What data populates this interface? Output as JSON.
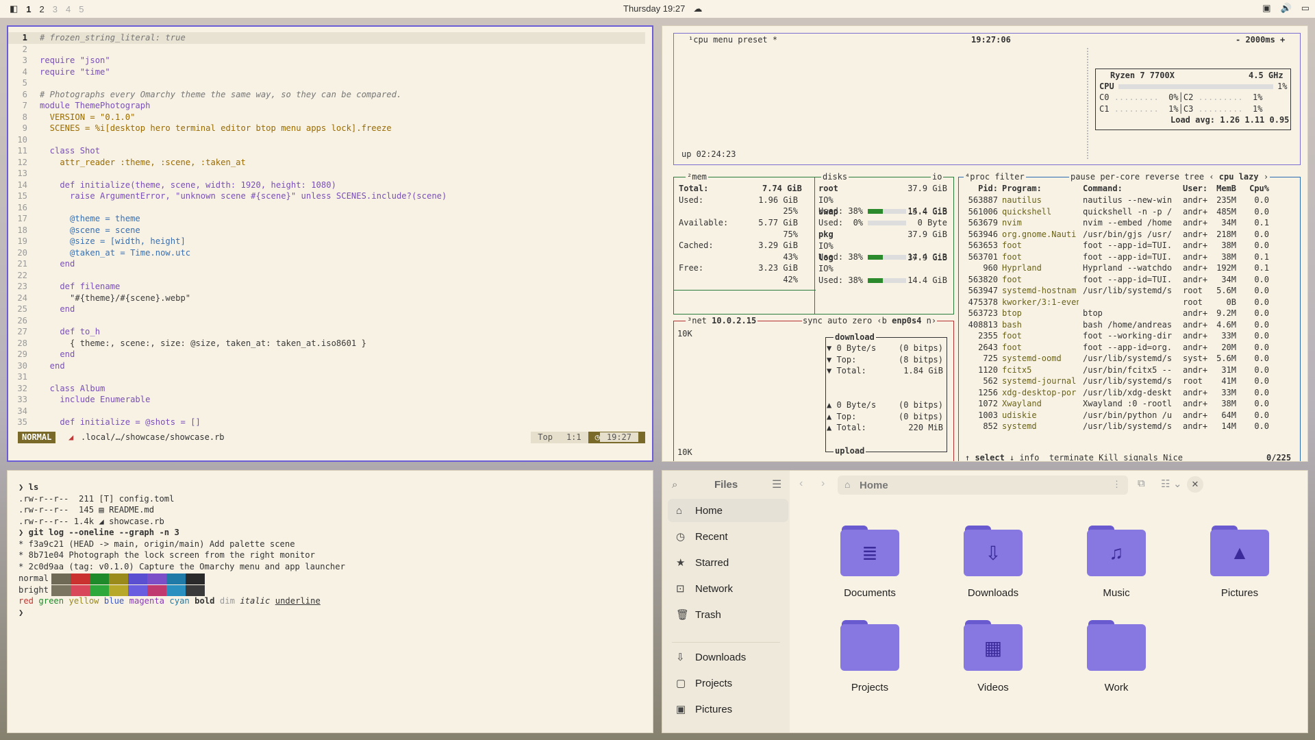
{
  "topbar": {
    "workspaces": [
      "1",
      "2",
      "3",
      "4",
      "5"
    ],
    "active": "1",
    "clock": "Thursday 19:27"
  },
  "editor": {
    "lines": [
      {
        "n": "1",
        "t": "# frozen_string_literal: true"
      },
      {
        "n": "2",
        "t": ""
      },
      {
        "n": "3",
        "t": "require \"json\""
      },
      {
        "n": "4",
        "t": "require \"time\""
      },
      {
        "n": "5",
        "t": ""
      },
      {
        "n": "6",
        "t": "# Photographs every Omarchy theme the same way, so they can be compared."
      },
      {
        "n": "7",
        "t": "module ThemePhotograph"
      },
      {
        "n": "8",
        "t": "  VERSION = \"0.1.0\""
      },
      {
        "n": "9",
        "t": "  SCENES = %i[desktop hero terminal editor btop menu apps lock].freeze"
      },
      {
        "n": "10",
        "t": ""
      },
      {
        "n": "11",
        "t": "  class Shot"
      },
      {
        "n": "12",
        "t": "    attr_reader :theme, :scene, :taken_at"
      },
      {
        "n": "13",
        "t": ""
      },
      {
        "n": "14",
        "t": "    def initialize(theme, scene, width: 1920, height: 1080)"
      },
      {
        "n": "15",
        "t": "      raise ArgumentError, \"unknown scene #{scene}\" unless SCENES.include?(scene)"
      },
      {
        "n": "16",
        "t": ""
      },
      {
        "n": "17",
        "t": "      @theme = theme"
      },
      {
        "n": "18",
        "t": "      @scene = scene"
      },
      {
        "n": "19",
        "t": "      @size = [width, height]"
      },
      {
        "n": "20",
        "t": "      @taken_at = Time.now.utc"
      },
      {
        "n": "21",
        "t": "    end"
      },
      {
        "n": "22",
        "t": ""
      },
      {
        "n": "23",
        "t": "    def filename"
      },
      {
        "n": "24",
        "t": "      \"#{theme}/#{scene}.webp\""
      },
      {
        "n": "25",
        "t": "    end"
      },
      {
        "n": "26",
        "t": ""
      },
      {
        "n": "27",
        "t": "    def to_h"
      },
      {
        "n": "28",
        "t": "      { theme:, scene:, size: @size, taken_at: taken_at.iso8601 }"
      },
      {
        "n": "29",
        "t": "    end"
      },
      {
        "n": "30",
        "t": "  end"
      },
      {
        "n": "31",
        "t": ""
      },
      {
        "n": "32",
        "t": "  class Album"
      },
      {
        "n": "33",
        "t": "    include Enumerable"
      },
      {
        "n": "34",
        "t": ""
      },
      {
        "n": "35",
        "t": "    def initialize = @shots = []"
      }
    ],
    "status": {
      "mode": "NORMAL",
      "file": ".local/…/showcase/showcase.rb",
      "pos": "Top",
      "cursor": "1:1",
      "time": "19:27"
    }
  },
  "btop": {
    "cpu": {
      "tab": "cpu",
      "menu": "menu",
      "preset": "preset *",
      "clock": "19:27:06",
      "interval": "- 2000ms +",
      "uptime": "up 02:24:23",
      "model": "Ryzen 7 7700X",
      "freq": "4.5 GHz",
      "total_label": "CPU",
      "total": "1%",
      "c0": "0%",
      "c1": "1%",
      "c2": "1%",
      "c3": "1%",
      "load": "Load avg: 1.26 1.11 0.95"
    },
    "mem": {
      "title": "mem",
      "total": "7.74 GiB",
      "used": "1.96 GiB",
      "used_pct": "25%",
      "avail": "5.77 GiB",
      "avail_pct": "75%",
      "cached": "3.29 GiB",
      "cached_pct": "43%",
      "free": "3.23 GiB",
      "free_pct": "42%"
    },
    "disks": {
      "title": "disks",
      "io": "io",
      "items": [
        {
          "name": "root",
          "size": "37.9 GiB",
          "io": "IO%",
          "used": "Used: 38%",
          "cap": "14.4 GiB",
          "pct": 0.38
        },
        {
          "name": "swap",
          "size": "15.4 GiB",
          "io": "",
          "used": "Used:  0%",
          "cap": "0 Byte",
          "pct": 0.0
        },
        {
          "name": "pkg",
          "size": "37.9 GiB",
          "io": "IO%",
          "used": "Used: 38%",
          "cap": "14.4 GiB",
          "pct": 0.38
        },
        {
          "name": "log",
          "size": "37.9 GiB",
          "io": "IO%",
          "used": "Used: 38%",
          "cap": "14.4 GiB",
          "pct": 0.38
        }
      ]
    },
    "net": {
      "title": "net",
      "ip": "10.0.2.15",
      "sync": "sync",
      "auto": "auto",
      "zero": "zero",
      "iface": "enp0s4",
      "scale_top": "10K",
      "scale_bottom": "10K",
      "dl_title": "download",
      "dl_rate": "0 Byte/s",
      "dl_bits": "(0 bitps)",
      "dl_top": "(8 bitps)",
      "dl_total": "1.84 GiB",
      "ul_title": "upload",
      "ul_rate": "0 Byte/s",
      "ul_bits": "(0 bitps)",
      "ul_top": "(0 bitps)",
      "ul_total": "220 MiB"
    },
    "proc": {
      "title": "proc",
      "filter": "filter",
      "pause": "pause",
      "percore": "per-core",
      "reverse": "reverse",
      "tree": "tree",
      "sort": "cpu lazy",
      "headers": [
        "Pid:",
        "Program:",
        "Command:",
        "User:",
        "MemB",
        "Cpu%"
      ],
      "rows": [
        [
          "563887",
          "nautilus",
          "nautilus --new-win",
          "andr+",
          "235M",
          "0.0"
        ],
        [
          "561006",
          "quickshell",
          "quickshell -n -p /",
          "andr+",
          "485M",
          "0.0"
        ],
        [
          "563679",
          "nvim",
          "nvim --embed /home",
          "andr+",
          "34M",
          "0.1"
        ],
        [
          "563946",
          "org.gnome.Nauti",
          "/usr/bin/gjs /usr/",
          "andr+",
          "218M",
          "0.0"
        ],
        [
          "563653",
          "foot",
          "foot --app-id=TUI.",
          "andr+",
          "38M",
          "0.0"
        ],
        [
          "563701",
          "foot",
          "foot --app-id=TUI.",
          "andr+",
          "38M",
          "0.1"
        ],
        [
          "960",
          "Hyprland",
          "Hyprland --watchdo",
          "andr+",
          "192M",
          "0.1"
        ],
        [
          "563820",
          "foot",
          "foot --app-id=TUI.",
          "andr+",
          "34M",
          "0.0"
        ],
        [
          "563947",
          "systemd-hostnam",
          "/usr/lib/systemd/s",
          "root",
          "5.6M",
          "0.0"
        ],
        [
          "475378",
          "kworker/3:1-even",
          "",
          "root",
          "0B",
          "0.0"
        ],
        [
          "563723",
          "btop",
          "btop",
          "andr+",
          "9.2M",
          "0.0"
        ],
        [
          "408813",
          "bash",
          "bash /home/andreas",
          "andr+",
          "4.6M",
          "0.0"
        ],
        [
          "2355",
          "foot",
          "foot --working-dir",
          "andr+",
          "33M",
          "0.0"
        ],
        [
          "2643",
          "foot",
          "foot --app-id=org.",
          "andr+",
          "20M",
          "0.0"
        ],
        [
          "725",
          "systemd-oomd",
          "/usr/lib/systemd/s",
          "syst+",
          "5.6M",
          "0.0"
        ],
        [
          "1120",
          "fcitx5",
          "/usr/bin/fcitx5 --",
          "andr+",
          "31M",
          "0.0"
        ],
        [
          "562",
          "systemd-journal",
          "/usr/lib/systemd/s",
          "root",
          "41M",
          "0.0"
        ],
        [
          "1256",
          "xdg-desktop-por",
          "/usr/lib/xdg-deskt",
          "andr+",
          "33M",
          "0.0"
        ],
        [
          "1072",
          "Xwayland",
          "Xwayland :0 -rootl",
          "andr+",
          "38M",
          "0.0"
        ],
        [
          "1003",
          "udiskie",
          "/usr/bin/python /u",
          "andr+",
          "64M",
          "0.0"
        ],
        [
          "852",
          "systemd",
          "/usr/lib/systemd/s",
          "andr+",
          "14M",
          "0.0"
        ]
      ],
      "footer": {
        "select": "select",
        "info": "info",
        "terminate": "terminate",
        "kill": "Kill",
        "signals": "signals",
        "nice": "Nice",
        "count": "0/225"
      }
    }
  },
  "terminal": {
    "lines": [
      "❯ ls",
      ".rw-r--r--  211 [T] config.toml",
      ".rw-r--r--  145 ▤ README.md",
      ".rw-r--r-- 1.4k ◢ showcase.rb",
      "❯ git log --oneline --graph -n 3",
      "* f3a9c21 (HEAD -> main, origin/main) Add palette scene",
      "* 8b71e04 Photograph the lock screen from the right monitor",
      "* 2c0d9aa (tag: v0.1.0) Capture the Omarchy menu and app launcher"
    ],
    "palette_normal_label": "normal",
    "palette_bright_label": "bright",
    "palette_normal": [
      "#6f6a55",
      "#c9322f",
      "#1f8a2a",
      "#9a8a1c",
      "#5a4fd0",
      "#7a4fc8",
      "#1f7aa8",
      "#2a2a2a"
    ],
    "palette_bright": [
      "#7a7560",
      "#d8485a",
      "#2ea83a",
      "#b8a82a",
      "#6a5ee0",
      "#c03a70",
      "#2a90c0",
      "#3a3a3a"
    ],
    "styles": [
      "red",
      "green",
      "yellow",
      "blue",
      "magenta",
      "cyan",
      "bold",
      "dim",
      "italic",
      "underline"
    ],
    "prompt": "❯"
  },
  "files": {
    "title": "Files",
    "location": "Home",
    "sidebar": [
      "Home",
      "Recent",
      "Starred",
      "Network",
      "Trash",
      "Downloads",
      "Projects",
      "Pictures"
    ],
    "folders": [
      "Documents",
      "Downloads",
      "Music",
      "Pictures",
      "Projects",
      "Videos",
      "Work"
    ]
  }
}
